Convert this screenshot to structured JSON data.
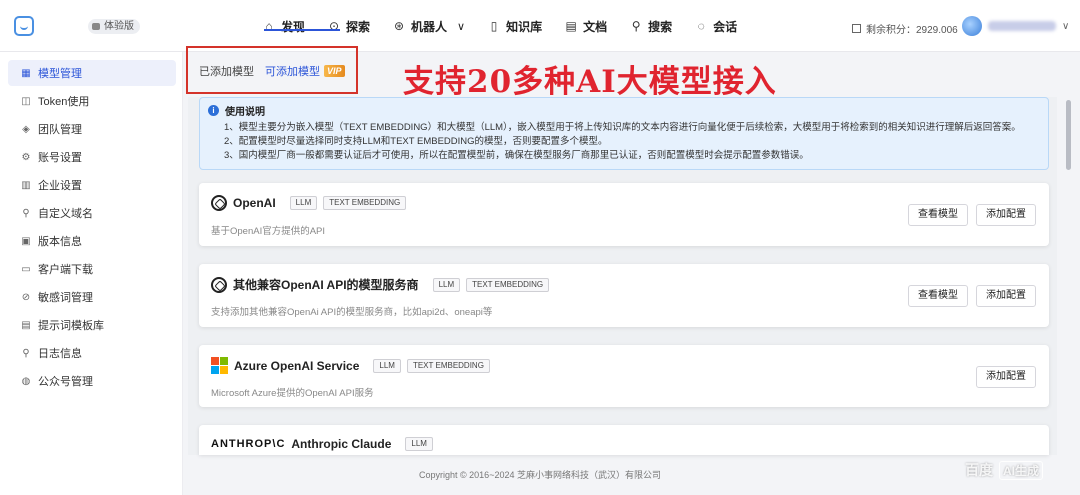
{
  "header": {
    "edition": "体验版",
    "nav": [
      {
        "icon": "home-icon",
        "glyph": "⌂",
        "label": "发现"
      },
      {
        "icon": "search-icon",
        "glyph": "⊙",
        "label": "探索"
      },
      {
        "icon": "robot-icon",
        "glyph": "⊛",
        "label": "机器人"
      },
      {
        "icon": "book-icon",
        "glyph": "▯",
        "label": "知识库"
      },
      {
        "icon": "document-icon",
        "glyph": "▤",
        "label": "文档"
      },
      {
        "icon": "magnifier-icon",
        "glyph": "⚲",
        "label": "搜索"
      },
      {
        "icon": "chat-icon",
        "glyph": "◌",
        "label": "会话"
      }
    ],
    "points": "剩余积分：2929.006"
  },
  "sidebar": {
    "items": [
      {
        "icon": "model-icon",
        "label": "模型管理",
        "active": true
      },
      {
        "icon": "token-icon",
        "label": "Token使用"
      },
      {
        "icon": "team-icon",
        "label": "团队管理"
      },
      {
        "icon": "account-icon",
        "label": "账号设置"
      },
      {
        "icon": "company-icon",
        "label": "企业设置"
      },
      {
        "icon": "domain-icon",
        "label": "自定义域名"
      },
      {
        "icon": "version-icon",
        "label": "版本信息"
      },
      {
        "icon": "download-icon",
        "label": "客户端下载"
      },
      {
        "icon": "sensitive-icon",
        "label": "敏感词管理"
      },
      {
        "icon": "template-icon",
        "label": "提示词模板库"
      },
      {
        "icon": "log-icon",
        "label": "日志信息"
      },
      {
        "icon": "wechat-icon",
        "label": "公众号管理"
      }
    ]
  },
  "tabs": {
    "added": "已添加模型",
    "available": "可添加模型",
    "vip": "VIP"
  },
  "promo": "支持20多种AI大模型接入",
  "info": {
    "title": "使用说明",
    "lines": [
      "1、模型主要分为嵌入模型（TEXT EMBEDDING）和大模型（LLM），嵌入模型用于将上传知识库的文本内容进行向量化便于后续检索，大模型用于将检索到的相关知识进行理解后返回答案。",
      "2、配置模型时尽量选择同时支持LLM和TEXT EMBEDDING的模型，否则要配置多个模型。",
      "3、国内模型厂商一般都需要认证后才可使用，所以在配置模型前，确保在模型服务厂商那里已认证，否则配置模型时会提示配置参数错误。"
    ]
  },
  "cards": [
    {
      "name": "OpenAI",
      "tags": [
        "LLM",
        "TEXT EMBEDDING"
      ],
      "desc": "基于OpenAI官方提供的API",
      "view": "查看模型",
      "add": "添加配置"
    },
    {
      "name": "其他兼容OpenAI API的模型服务商",
      "tags": [
        "LLM",
        "TEXT EMBEDDING"
      ],
      "desc": "支持添加其他兼容OpenAi API的模型服务商，比如api2d、oneapi等",
      "view": "查看模型",
      "add": "添加配置"
    },
    {
      "name": "Azure OpenAI Service",
      "tags": [
        "LLM",
        "TEXT EMBEDDING"
      ],
      "desc": "Microsoft Azure提供的OpenAI API服务",
      "add": "添加配置"
    },
    {
      "logo_text": "ANTHROP\\C",
      "name": "Anthropic Claude",
      "tags": [
        "LLM"
      ]
    }
  ],
  "footer": "Copyright © 2016~2024 芝麻小事网络科技（武汉）有限公司",
  "watermark": {
    "brand": "百度",
    "badge": "AI生成"
  }
}
